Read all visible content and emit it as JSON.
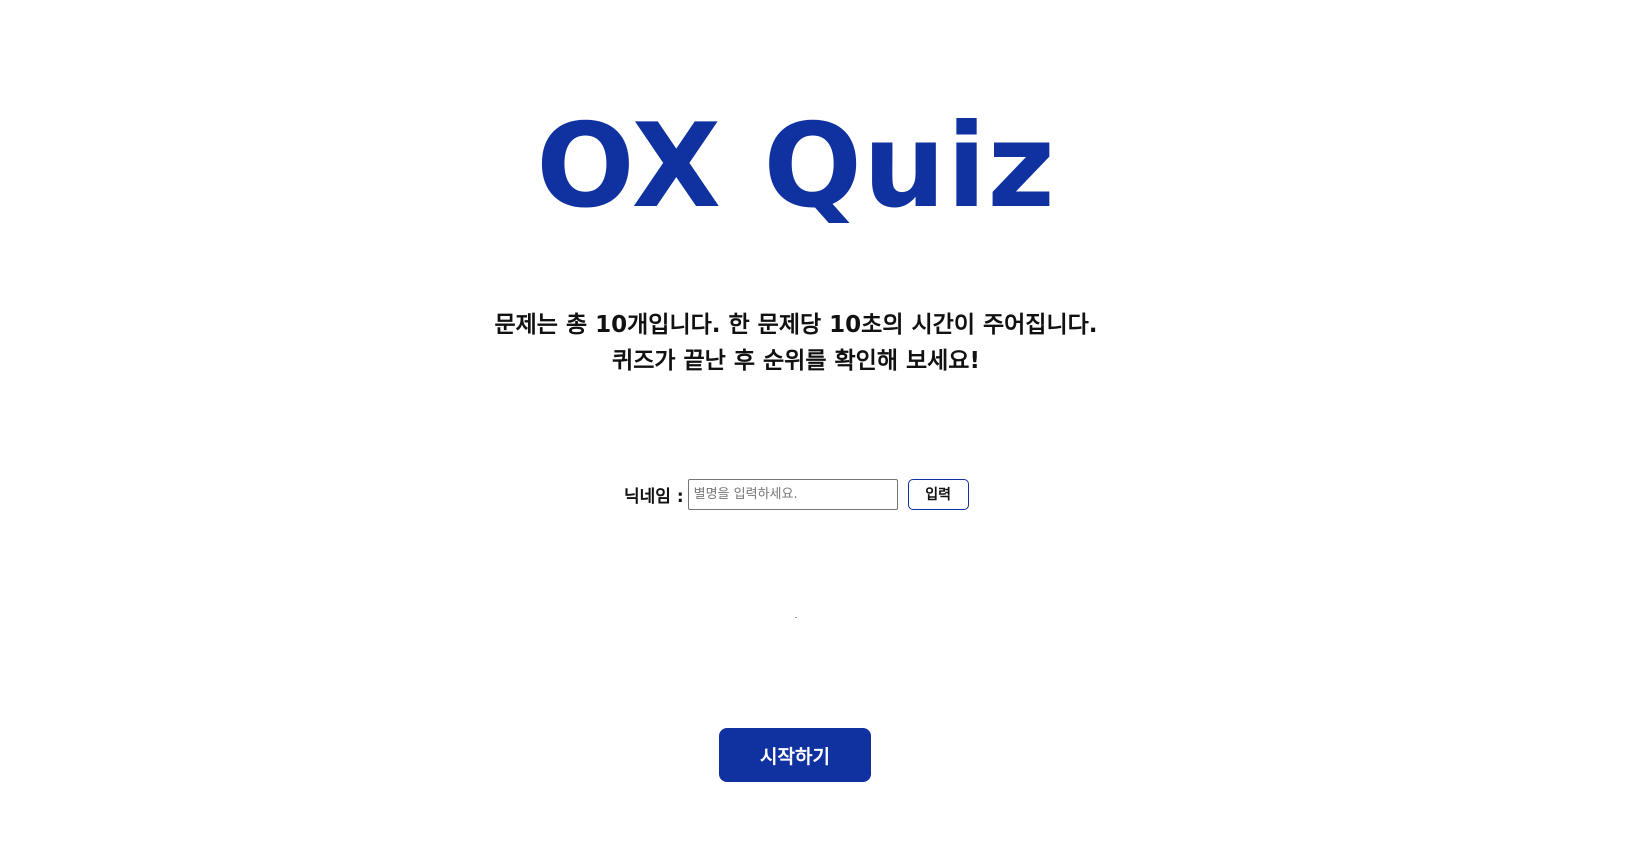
{
  "title": "OX Quiz",
  "intro": {
    "line1": "문제는 총 10개입니다. 한 문제당 10초의 시간이 주어집니다.",
    "line2": "퀴즈가 끝난 후 순위를 확인해 보세요!"
  },
  "nickname": {
    "label": "닉네임 :",
    "placeholder": "별명을 입력하세요.",
    "value": "",
    "submit_label": "입력"
  },
  "start_button": {
    "label": "시작하기"
  },
  "colors": {
    "accent": "#0f32a0",
    "text": "#111111",
    "background": "#ffffff"
  }
}
